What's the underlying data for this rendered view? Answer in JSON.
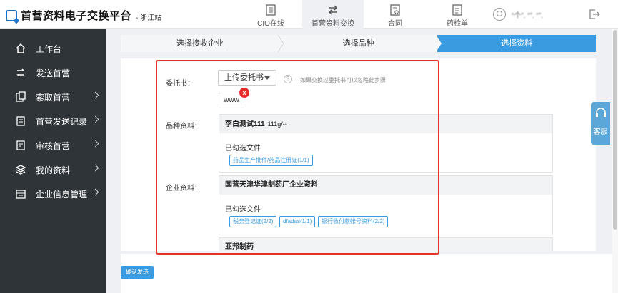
{
  "header": {
    "logo_title": "首营资料电子交换平台",
    "logo_sub": "- 浙江站",
    "nav": [
      {
        "label": "CIO在线",
        "icon": "document-icon",
        "active": false
      },
      {
        "label": "首营资料交换",
        "icon": "exchange-icon",
        "active": true
      },
      {
        "label": "合同",
        "icon": "contract-icon",
        "active": false
      },
      {
        "label": "药检单",
        "icon": "report-icon",
        "active": false
      }
    ],
    "user_name": "“个”.  “”. “”."
  },
  "sidebar": {
    "items": [
      {
        "label": "工作台",
        "icon": "home-icon",
        "has_arrow": false
      },
      {
        "label": "发送首营",
        "icon": "send-icon",
        "has_arrow": false
      },
      {
        "label": "索取首营",
        "icon": "request-icon",
        "has_arrow": true
      },
      {
        "label": "首营发送记录",
        "icon": "record-icon",
        "has_arrow": true
      },
      {
        "label": "审核首营",
        "icon": "audit-icon",
        "has_arrow": true
      },
      {
        "label": "我的资料",
        "icon": "layers-icon",
        "has_arrow": true
      },
      {
        "label": "企业信息管理",
        "icon": "company-icon",
        "has_arrow": true
      }
    ]
  },
  "steps": [
    "选择接收企业",
    "选择品种",
    "选择资料"
  ],
  "form": {
    "entrust_label": "委托书：",
    "upload_label": "上传委托书",
    "hint": "如果交换过委托书可以忽略此步骤",
    "file_name": "www",
    "delete_badge": "x",
    "product_label": "品种资料：",
    "product": {
      "name": "李白测试111",
      "spec": "111g/--",
      "selected_label": "已勾选文件",
      "tags": [
        "药品生产批件/药品注册证(1/1)"
      ]
    },
    "company_label": "企业资料：",
    "companies": [
      {
        "name": "国营天津华津制药厂企业资料",
        "selected_label": "已勾选文件",
        "tags": [
          "税务登记证(2/2)",
          "dfadas(1/1)",
          "银行收付款帐号资料(2/2)"
        ]
      },
      {
        "name": "亚邦制药"
      }
    ]
  },
  "confirm_label": "确认发送",
  "kefu_label": "客服",
  "colors": {
    "accent": "#3a9be0",
    "sidebar_bg": "#2f3439",
    "highlight": "#e5332a"
  }
}
